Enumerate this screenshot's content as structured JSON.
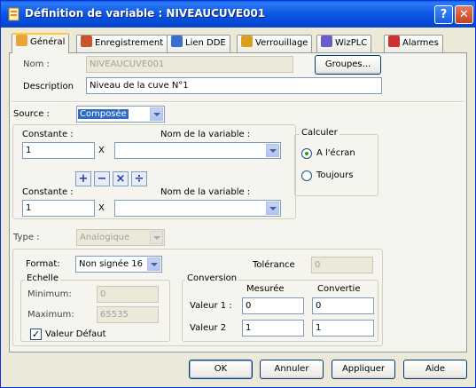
{
  "window": {
    "title": "Définition de variable : NIVEAUCUVE001",
    "help_label": "?",
    "close_label": "✕"
  },
  "tabs": [
    {
      "label": "Général",
      "icon": "page-icon",
      "color": "#E8A33A"
    },
    {
      "label": "Enregistrement",
      "icon": "record-icon",
      "color": "#C8542A"
    },
    {
      "label": "Lien DDE",
      "icon": "link-icon",
      "color": "#3A6FD0"
    },
    {
      "label": "Verrouillage",
      "icon": "lock-icon",
      "color": "#D9A020"
    },
    {
      "label": "WizPLC",
      "icon": "plc-icon",
      "color": "#6A5ACD"
    },
    {
      "label": "Alarmes",
      "icon": "alarm-icon",
      "color": "#D03030"
    }
  ],
  "general": {
    "nom_label": "Nom :",
    "nom_value": "NIVEAUCUVE001",
    "groupes_label": "Groupes...",
    "description_label": "Description",
    "description_value": "Niveau de la cuve N°1",
    "source_label": "Source :",
    "source_value": "Composée"
  },
  "composite": {
    "constante1_label": "Constante :",
    "constante1_value": "1",
    "times1": "X",
    "var1_label": "Nom de la variable :",
    "var1_value": "",
    "ops": [
      "+",
      "−",
      "×",
      "÷"
    ],
    "constante2_label": "Constante :",
    "constante2_value": "1",
    "times2": "X",
    "var2_label": "Nom de la variable :",
    "var2_value": ""
  },
  "calculer": {
    "title": "Calculer",
    "option1": "A l'écran",
    "option2": "Toujours"
  },
  "type": {
    "label": "Type :",
    "value": "Analogique"
  },
  "format": {
    "label": "Format:",
    "value": "Non signée 16",
    "tolerance_label": "Tolérance",
    "tolerance_value": "0"
  },
  "echelle": {
    "title": "Echelle",
    "minimum_label": "Minimum:",
    "minimum_value": "0",
    "maximum_label": "Maximum:",
    "maximum_value": "65535",
    "valeur_defaut_label": "Valeur Défaut",
    "check_mark": "✓"
  },
  "conversion": {
    "title": "Conversion",
    "mesuree_label": "Mesurée",
    "convertie_label": "Convertie",
    "valeur1_label": "Valeur 1 :",
    "valeur1_mesuree": "0",
    "valeur1_convertie": "0",
    "valeur2_label": "Valeur 2",
    "valeur2_mesuree": "1",
    "valeur2_convertie": "1"
  },
  "buttons": {
    "ok": "OK",
    "annuler": "Annuler",
    "appliquer": "Appliquer",
    "aide": "Aide"
  }
}
